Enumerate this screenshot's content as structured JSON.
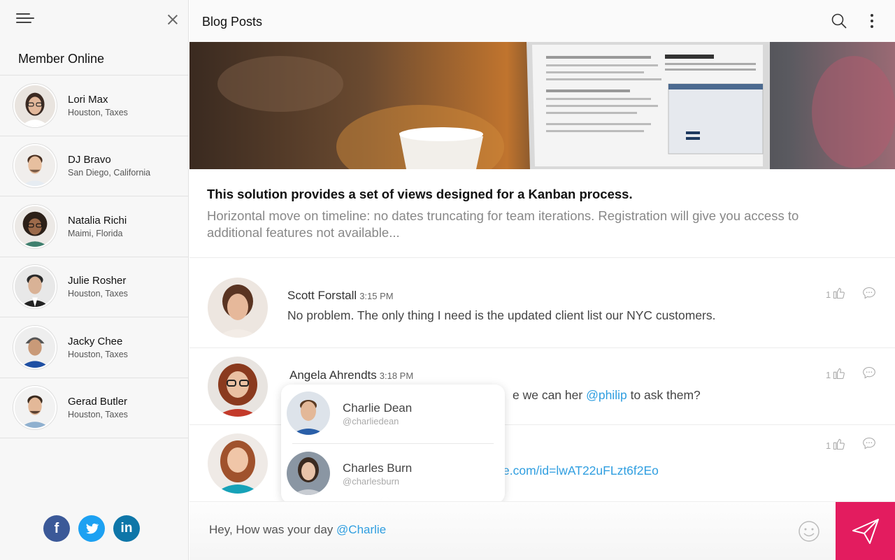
{
  "sidebar": {
    "title": "Member Online",
    "members": [
      {
        "name": "Lori Max",
        "location": "Houston, Taxes"
      },
      {
        "name": "DJ Bravo",
        "location": "San Diego, California"
      },
      {
        "name": "Natalia Richi",
        "location": "Maimi, Florida"
      },
      {
        "name": "Julie Rosher",
        "location": "Houston, Taxes"
      },
      {
        "name": "Jacky Chee",
        "location": "Houston, Taxes"
      },
      {
        "name": "Gerad Butler",
        "location": "Houston, Taxes"
      }
    ],
    "socials": [
      {
        "name": "facebook",
        "glyph": "f",
        "color": "#3b5998"
      },
      {
        "name": "twitter",
        "glyph": "t",
        "color": "#1da1f2"
      },
      {
        "name": "linkedin",
        "glyph": "in",
        "color": "#0e76a8"
      }
    ]
  },
  "header": {
    "title": "Blog Posts"
  },
  "post": {
    "title": "This solution provides a set of views designed for a Kanban process.",
    "description": "Horizontal move on timeline: no dates truncating for team iterations. Registration will give you access to additional features not available..."
  },
  "comments": [
    {
      "author": "Scott Forstall",
      "time": "3:15 PM",
      "text": "No problem. The only thing I need is the updated client list our NYC customers.",
      "likes": "1"
    },
    {
      "author": "Angela Ahrendts",
      "time": "3:18 PM",
      "text_visible": "e we can her",
      "mention": "@philip",
      "text_after": "to ask them?",
      "likes": "1"
    },
    {
      "author": "",
      "time": "",
      "link_visible": "e.com/id=lwAT22uFLzt6f2Eo",
      "likes": "1"
    }
  ],
  "mention_popup": {
    "items": [
      {
        "name": "Charlie Dean",
        "handle": "@charliedean"
      },
      {
        "name": "Charles Burn",
        "handle": "@charlesburn"
      }
    ]
  },
  "composer": {
    "text": "Hey, How was your day",
    "mention": "@Charlie"
  },
  "colors": {
    "accent": "#e31c5f",
    "link": "#2f9ee0"
  }
}
